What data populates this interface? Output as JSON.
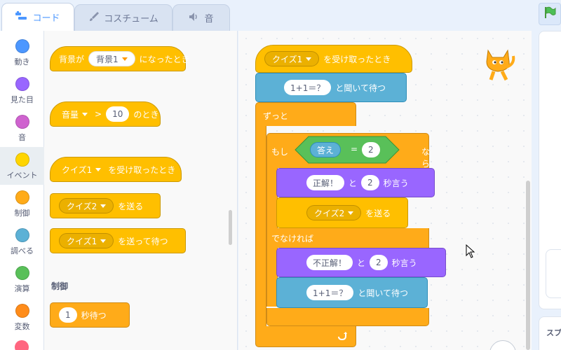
{
  "tabs": {
    "code": "コード",
    "costumes": "コスチューム",
    "sounds": "音"
  },
  "categories": [
    {
      "label": "動き",
      "color": "#4c97ff"
    },
    {
      "label": "見た目",
      "color": "#9966ff"
    },
    {
      "label": "音",
      "color": "#cf63cf"
    },
    {
      "label": "イベント",
      "color": "#ffd500"
    },
    {
      "label": "制御",
      "color": "#ffab19"
    },
    {
      "label": "調べる",
      "color": "#5cb1d6"
    },
    {
      "label": "演算",
      "color": "#59c059"
    },
    {
      "label": "変数",
      "color": "#ff8c1a"
    }
  ],
  "palette": {
    "backdrop_prefix": "背景が",
    "backdrop_value": "背景1",
    "backdrop_suffix": "になったとき",
    "loudness_value": "音量",
    "gt": ">",
    "loudness_threshold": "10",
    "loudness_suffix": "のとき",
    "receive_value": "クイズ1",
    "receive_suffix": "を受け取ったとき",
    "broadcast_value": "クイズ2",
    "broadcast_suffix": "を送る",
    "broadcast_wait_value": "クイズ1",
    "broadcast_wait_suffix": "を送って待つ",
    "control_heading": "制御",
    "wait_value": "1",
    "wait_suffix": "秒待つ"
  },
  "script": {
    "hat_value": "クイズ1",
    "hat_suffix": "を受け取ったとき",
    "ask1_value": "1+1＝？",
    "ask_suffix": "と聞いて待つ",
    "forever_label": "ずっと",
    "if_label": "もし",
    "answer_reporter": "答え",
    "equals": "=",
    "compare_value": "2",
    "then_label": "なら",
    "say1_value": "正解！",
    "say_and": "と",
    "say1_secs": "2",
    "say_suffix": "秒言う",
    "broadcast_value": "クイズ2",
    "broadcast_suffix": "を送る",
    "else_label": "でなければ",
    "say2_value": "不正解！",
    "say2_secs": "2",
    "ask2_value": "1+1＝？"
  },
  "sprites_label": "スプ"
}
